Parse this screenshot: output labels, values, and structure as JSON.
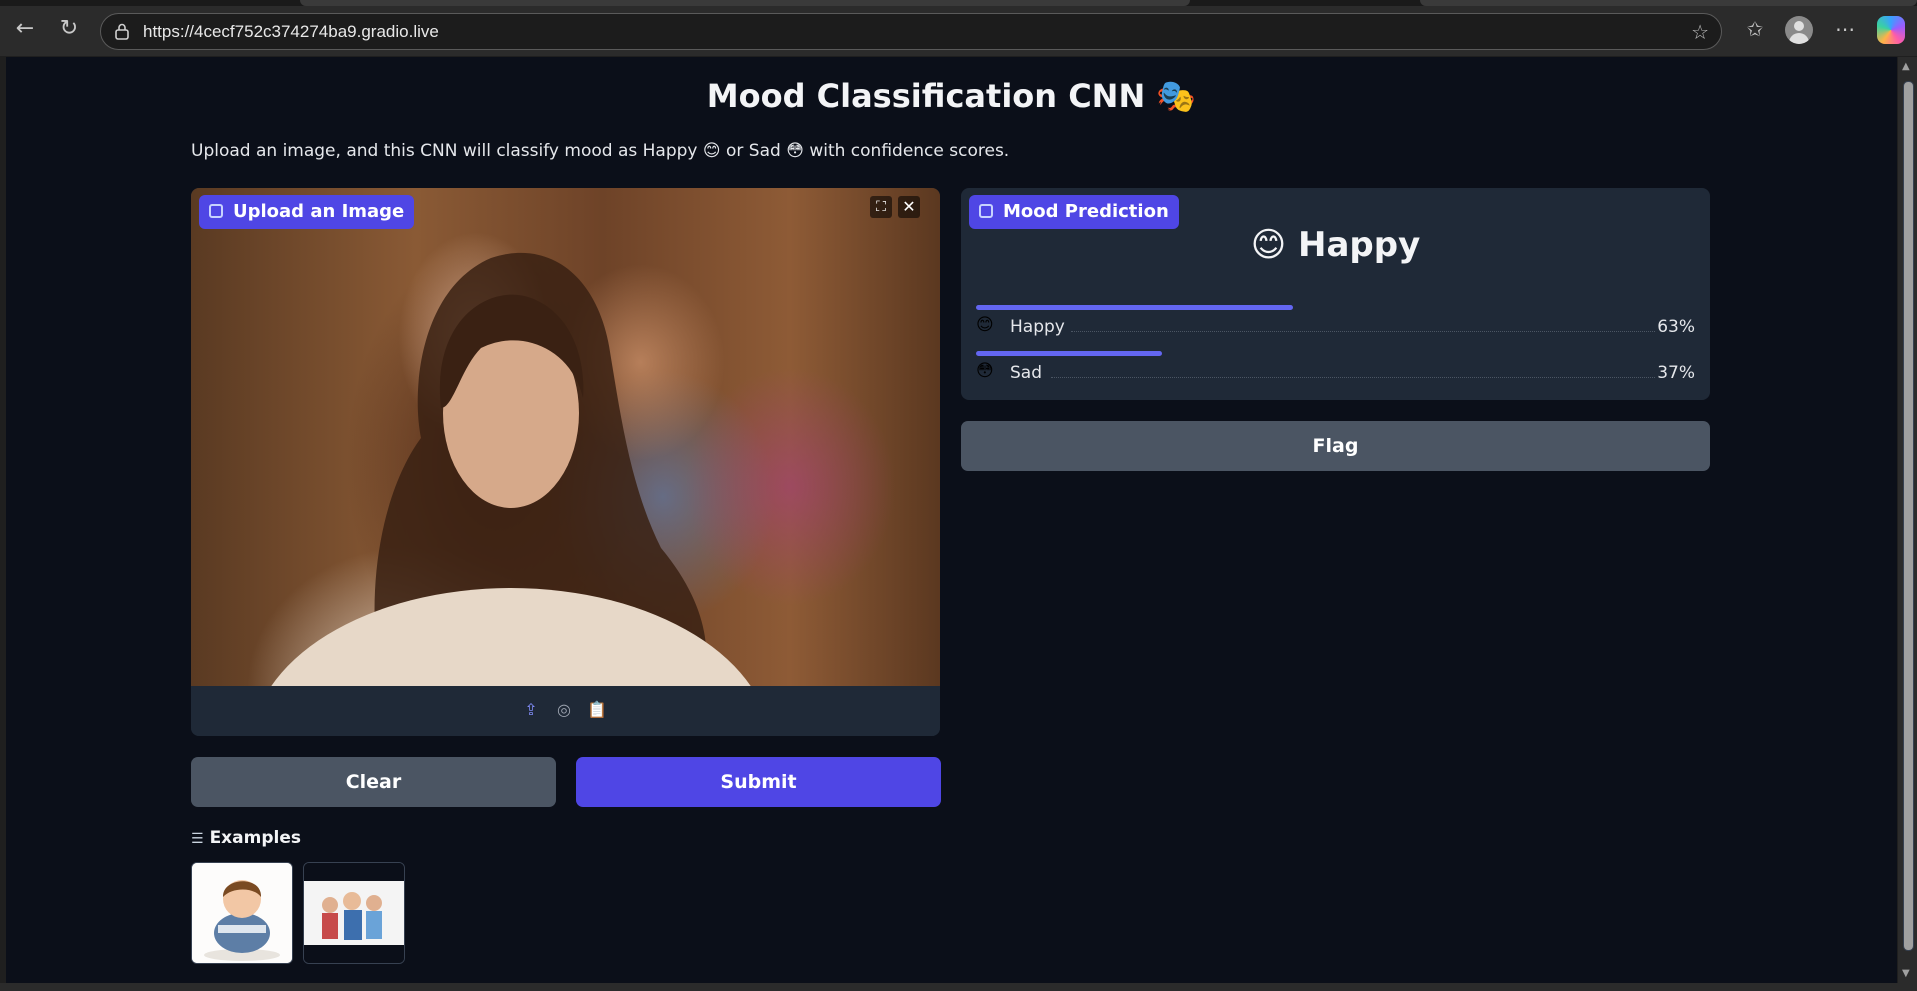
{
  "browser": {
    "url": "https://4cecf752c374274ba9.gradio.live",
    "icons": [
      "back-icon",
      "reload-icon",
      "lock-icon",
      "star-icon",
      "favorites-icon",
      "profile-icon",
      "more-icon",
      "copilot-icon"
    ]
  },
  "header": {
    "title": "Mood Classification CNN 🎭",
    "subtitle": "Upload an image, and this CNN will classify mood as Happy 😊 or Sad 😳 with confidence scores."
  },
  "input_panel": {
    "label": "Upload an Image"
  },
  "buttons": {
    "clear": "Clear",
    "submit": "Submit",
    "flag": "Flag"
  },
  "examples": {
    "heading": "Examples"
  },
  "output_panel": {
    "label": "Mood Prediction",
    "top_prediction": "😊 Happy",
    "confidences": [
      {
        "emoji": "😊",
        "label": "Happy",
        "percent": "63%",
        "value": 0.63
      },
      {
        "emoji": "😳",
        "label": "Sad",
        "percent": "37%",
        "value": 0.37
      }
    ]
  },
  "colors": {
    "page_bg": "#0b0f19",
    "panel_bg": "#1f2937",
    "primary": "#4f46e5",
    "secondary_button": "#4b5563",
    "bar": "#6366f1"
  }
}
